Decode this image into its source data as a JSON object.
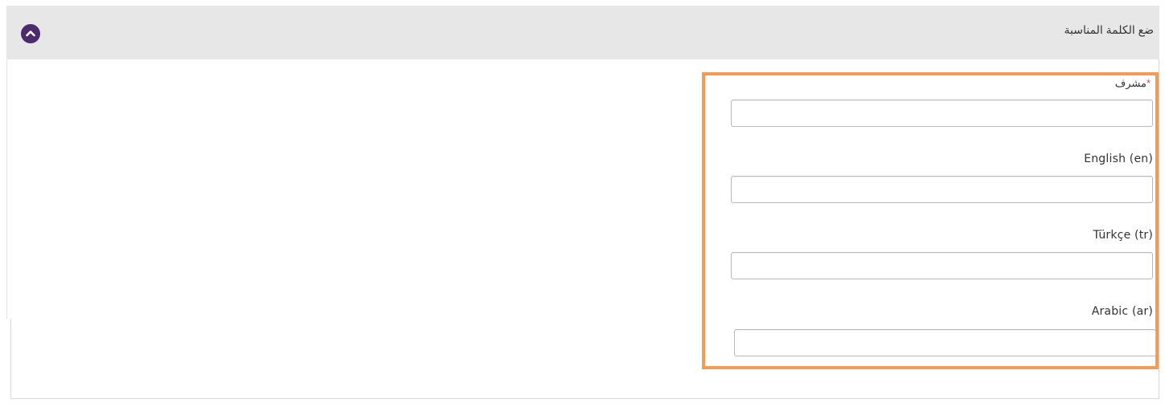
{
  "panel": {
    "title": "ضع الكلمة المناسبة",
    "collapse_icon": "chevron-up-icon",
    "accent_color": "#4b2a6e",
    "highlight_color": "#f59a55"
  },
  "fields": [
    {
      "label": "مشرف",
      "required_marker": "*",
      "value": ""
    },
    {
      "label": "English (en)",
      "value": ""
    },
    {
      "label": "Türkçe (tr)",
      "value": ""
    },
    {
      "label": "Arabic (ar)",
      "value": ""
    }
  ]
}
